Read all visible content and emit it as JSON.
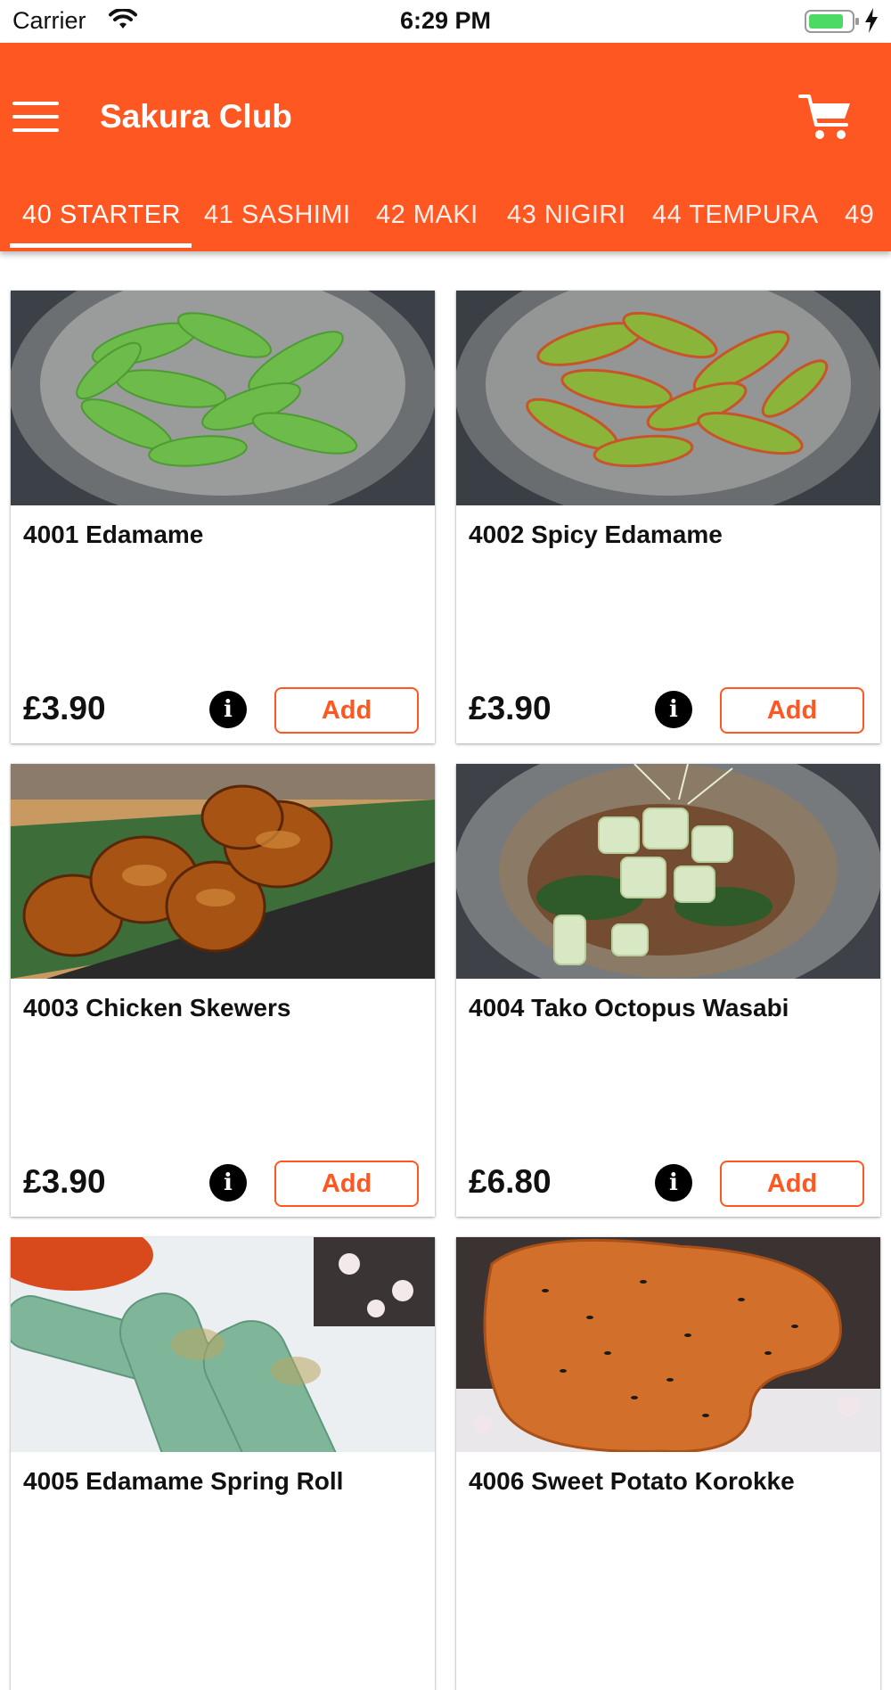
{
  "status_bar": {
    "carrier": "Carrier",
    "time": "6:29 PM"
  },
  "header": {
    "title": "Sakura Club",
    "menu_icon": "hamburger-menu-icon",
    "cart_icon": "shopping-cart-icon"
  },
  "colors": {
    "accent": "#ff5722",
    "header_text": "#ffffff"
  },
  "tabs": [
    {
      "label": "40 STARTER",
      "active": true
    },
    {
      "label": "41 SASHIMI",
      "active": false
    },
    {
      "label": "42 MAKI",
      "active": false
    },
    {
      "label": "43 NIGIRI",
      "active": false
    },
    {
      "label": "44 TEMPURA",
      "active": false
    },
    {
      "label": "49",
      "active": false
    }
  ],
  "products": [
    {
      "name": "4001 Edamame",
      "price": "£3.90",
      "add_label": "Add",
      "info_icon": "info-icon",
      "image": "edamame-photo"
    },
    {
      "name": "4002 Spicy Edamame",
      "price": "£3.90",
      "add_label": "Add",
      "info_icon": "info-icon",
      "image": "spicy-edamame-photo"
    },
    {
      "name": "4003 Chicken Skewers",
      "price": "£3.90",
      "add_label": "Add",
      "info_icon": "info-icon",
      "image": "chicken-skewers-photo"
    },
    {
      "name": "4004 Tako Octopus Wasabi",
      "price": "£6.80",
      "add_label": "Add",
      "info_icon": "info-icon",
      "image": "octopus-wasabi-photo"
    },
    {
      "name": "4005 Edamame Spring Roll",
      "image": "spring-roll-photo"
    },
    {
      "name": "4006 Sweet Potato Korokke",
      "image": "korokke-photo"
    }
  ]
}
